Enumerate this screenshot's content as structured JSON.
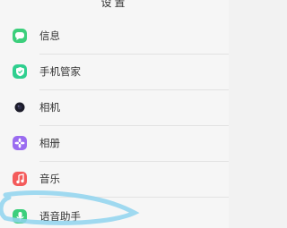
{
  "header": {
    "title": "设置"
  },
  "settings": {
    "items": [
      {
        "label": "信息",
        "icon": "message-icon",
        "color": "#3ccf7c"
      },
      {
        "label": "手机管家",
        "icon": "shield-icon",
        "color": "#2fcf8f"
      },
      {
        "label": "相机",
        "icon": "camera-icon",
        "color": "#1c1c2a"
      },
      {
        "label": "相册",
        "icon": "gallery-icon",
        "color": "#9a6cf0"
      },
      {
        "label": "音乐",
        "icon": "music-icon",
        "color": "#f45b5b"
      },
      {
        "label": "语音助手",
        "icon": "voice-assistant-icon",
        "color": "#3ccf7c"
      }
    ]
  },
  "annotation": {
    "color": "#8fd3ee"
  }
}
